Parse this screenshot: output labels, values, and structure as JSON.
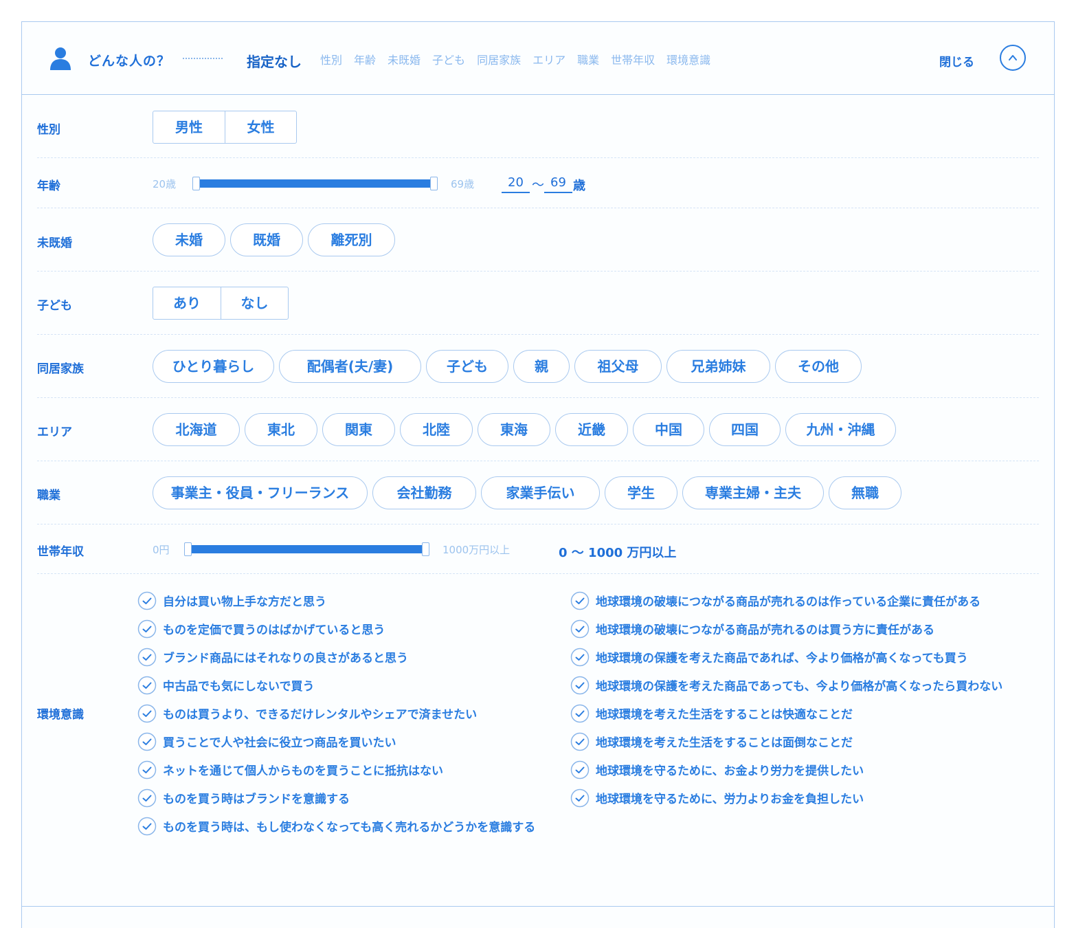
{
  "header": {
    "who_label": "どんな人の？",
    "current": "指定なし",
    "nav": [
      "性別",
      "年齢",
      "未既婚",
      "子ども",
      "同居家族",
      "エリア",
      "職業",
      "世帯年収",
      "環境意識"
    ],
    "close_label": "閉じる"
  },
  "gender": {
    "label": "性別",
    "options": [
      "男性",
      "女性"
    ]
  },
  "age": {
    "label": "年齢",
    "min_label": "20歳",
    "max_label": "69歳",
    "from": "20",
    "tilde": "〜",
    "to": "69",
    "unit": "歳",
    "range_from_fraction": 0,
    "range_to_fraction": 1
  },
  "marital": {
    "label": "未既婚",
    "options": [
      "未婚",
      "既婚",
      "離死別"
    ]
  },
  "children": {
    "label": "子ども",
    "options": [
      "あり",
      "なし"
    ]
  },
  "household": {
    "label": "同居家族",
    "options": [
      "ひとり暮らし",
      "配偶者(夫/妻)",
      "子ども",
      "親",
      "祖父母",
      "兄弟姉妹",
      "その他"
    ]
  },
  "area": {
    "label": "エリア",
    "options": [
      "北海道",
      "東北",
      "関東",
      "北陸",
      "東海",
      "近畿",
      "中国",
      "四国",
      "九州・沖縄"
    ]
  },
  "occupation": {
    "label": "職業",
    "options": [
      "事業主・役員・フリーランス",
      "会社勤務",
      "家業手伝い",
      "学生",
      "専業主婦・主夫",
      "無職"
    ]
  },
  "income": {
    "label": "世帯年収",
    "min_label": "0円",
    "max_label": "1000万円以上",
    "summary": "0 〜 1000 万円以上",
    "range_from_fraction": 0,
    "range_to_fraction": 1
  },
  "eco": {
    "label": "環境意識",
    "left": [
      "自分は買い物上手な方だと思う",
      "ものを定価で買うのはばかげていると思う",
      "ブランド商品にはそれなりの良さがあると思う",
      "中古品でも気にしないで買う",
      "ものは買うより、できるだけレンタルやシェアで済ませたい",
      "買うことで人や社会に役立つ商品を買いたい",
      "ネットを通じて個人からものを買うことに抵抗はない",
      "ものを買う時はブランドを意識する",
      "ものを買う時は、もし使わなくなっても高く売れるかどうかを意識する"
    ],
    "right": [
      "地球環境の破壊につながる商品が売れるのは作っている企業に責任がある",
      "地球環境の破壊につながる商品が売れるのは買う方に責任がある",
      "地球環境の保護を考えた商品であれば、今より価格が高くなっても買う",
      "地球環境の保護を考えた商品であっても、今より価格が高くなったら買わない",
      "地球環境を考えた生活をすることは快適なことだ",
      "地球環境を考えた生活をすることは面倒なことだ",
      "地球環境を守るために、お金より労力を提供したい",
      "地球環境を守るために、労力よりお金を負担したい"
    ]
  },
  "colors": {
    "accent": "#2a7de0",
    "border": "#a9c9ef",
    "muted": "#9cc3ee"
  },
  "icons": {
    "user": "user-icon",
    "close": "chevron-up-icon",
    "check": "check-circle-icon"
  }
}
